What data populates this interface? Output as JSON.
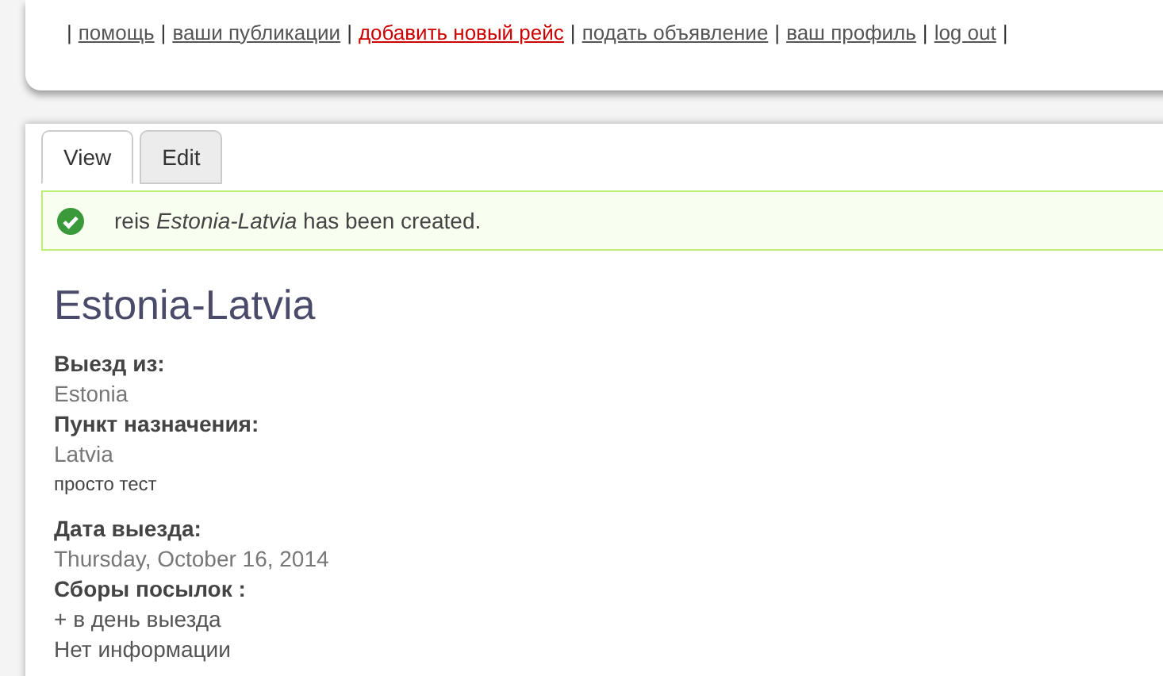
{
  "nav": {
    "separator": "|",
    "links": [
      {
        "label": "помощь",
        "active": false
      },
      {
        "label": "ваши публикации",
        "active": false
      },
      {
        "label": "добавить новый рейс",
        "active": true
      },
      {
        "label": "подать объявление",
        "active": false
      },
      {
        "label": "ваш профиль",
        "active": false
      },
      {
        "label": "log out",
        "active": false
      }
    ]
  },
  "tabs": [
    {
      "label": "View",
      "selected": true
    },
    {
      "label": "Edit",
      "selected": false
    }
  ],
  "message": {
    "text": "reis *Estonia-Latvia* has been created."
  },
  "title": "Estonia-Latvia",
  "sections": [
    {
      "items": [
        {
          "kind": "label",
          "text": "Выезд из:"
        },
        {
          "kind": "value",
          "text": "Estonia"
        },
        {
          "kind": "label",
          "text": "Пункт назначения:"
        },
        {
          "kind": "value",
          "text": "Latvia"
        },
        {
          "kind": "note",
          "text": "просто тест"
        }
      ]
    },
    {
      "items": [
        {
          "kind": "label",
          "text": "Дата выезда:"
        },
        {
          "kind": "value",
          "text": "Thursday, October 16, 2014"
        },
        {
          "kind": "label",
          "text": "Сборы посылок :"
        },
        {
          "kind": "text",
          "text": "+ в день выезда"
        },
        {
          "kind": "text",
          "text": "Нет информации"
        }
      ]
    }
  ]
}
